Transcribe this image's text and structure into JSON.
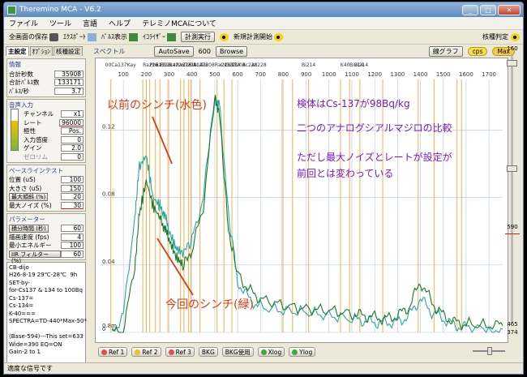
{
  "window": {
    "title": "Theremino MCA - V6.2"
  },
  "menu": [
    "ファイル",
    "ツール",
    "言語",
    "ヘルプ",
    "テレミノMCAについて"
  ],
  "toolbar": {
    "save_screen": "全画面の保存",
    "export": "ｴｸｽﾎﾟｰﾄ",
    "pulse_display": "ﾊﾟﾙｽ表示",
    "equalizer": "ｲｺﾗｲｻﾞｰ",
    "run_measure": "計測実行",
    "new_measure": "新規計測開始",
    "nuclide_id": "核種判定"
  },
  "left_tabs": [
    "主設定",
    "ｵﾌﾟｼｮﾝ",
    "核種設定"
  ],
  "info": {
    "title": "情報",
    "rows": [
      {
        "label": "合計秒数",
        "value": "35908"
      },
      {
        "label": "合計ﾊﾟﾙｽ数",
        "value": "133171"
      },
      {
        "label": "ﾊﾟﾙｽ/秒",
        "value": "3.7"
      }
    ]
  },
  "audio": {
    "title": "音声入力",
    "rows": [
      {
        "label": "チャンネル",
        "value": "x1"
      },
      {
        "label": "レート",
        "value": "96000"
      },
      {
        "label": "極性",
        "value": "Pos."
      },
      {
        "label": "入力感度",
        "value": "0"
      },
      {
        "label": "ゲイン",
        "value": "2.0"
      },
      {
        "label": "ゼロリム",
        "value": "0"
      }
    ]
  },
  "baseline": {
    "title": "ベースラインテスト",
    "rows": [
      {
        "label": "位置 (uS)",
        "value": "100"
      },
      {
        "label": "大きさ (uS)",
        "value": "150"
      },
      {
        "label": "最大傾斜 (%)",
        "value": "20"
      },
      {
        "label": "最大ノイズ (%)",
        "value": "30"
      }
    ]
  },
  "params": {
    "title": "パラメーター",
    "rows": [
      {
        "label": "積分時間 (秒)",
        "value": "60"
      },
      {
        "label": "描画速度 (fps)",
        "value": "4"
      },
      {
        "label": "最小エネルギー",
        "value": "100"
      },
      {
        "label": "IIR フィルター (%)",
        "value": "60"
      }
    ]
  },
  "notes": "CB-dijo\nH26-8-19 29℃-28℃  9h\nSET-by-\nfor-Cs137 & 134 to 100Bq\nCs-137=\nCs-134=\nK-40===\nSPECTRA=TD-440*Max-50*\n\n(Base-594)---This set=633\nWide=390 EQ=ON\nGain-2 to 1",
  "spectrum": {
    "title": "スペクトル",
    "autosave_label": "AutoSave",
    "autosave_value": "600",
    "browse_label": "Browse",
    "line_graph_label": "線グラフ",
    "cps_label": "cps",
    "max_label": "Max",
    "isotope_labels": [
      "00Ca137Kay",
      "Ra226",
      "Pb21",
      "Ra226",
      "Pb214",
      "Ra226",
      "Ra226",
      "Tl208",
      "Bi214",
      "Ac228",
      "Tl208",
      "Ra226",
      "Cs137",
      "Cs134",
      "Tl208",
      "Ac228",
      "Ac228",
      "Bi214",
      "K40",
      "Bi214",
      "Bi214"
    ]
  },
  "bottom_buttons": [
    {
      "label": "Ref 1",
      "color": "#e05050"
    },
    {
      "label": "Ref 2",
      "color": "#f0c020"
    },
    {
      "label": "Ref 3",
      "color": "#e05050"
    },
    {
      "label": "BKG",
      "color": ""
    },
    {
      "label": "BKG使用",
      "color": ""
    },
    {
      "label": "Xlog",
      "color": "#3aaa3a"
    },
    {
      "label": "Ylog",
      "color": "#3aaa3a"
    }
  ],
  "right_values": {
    "top": "160",
    "mid": "590",
    "bottom1": "465",
    "bottom2": "374"
  },
  "status": "適度な信号です",
  "annotations": {
    "sample": "検体はCs-137が98Bq/kg",
    "compare": "二つのアナログシアルマジロの比較",
    "note1": "ただし最大ノイズとレートが設定が",
    "note2": "前回とは変わっている",
    "prev": "以前のシンチ(水色)",
    "current": "今回のシンチ(緑)"
  },
  "chart_data": {
    "type": "line",
    "xlabel": "",
    "ylabel": "",
    "x_ticks": [
      100,
      200,
      300,
      400,
      500,
      600,
      700,
      800,
      900,
      1000,
      1100,
      1200,
      1300,
      1400,
      1500,
      1600,
      1700
    ],
    "y_ticks": [
      "0.12",
      "0.08",
      "0.04",
      "0",
      "0.8m"
    ],
    "series": [
      {
        "name": "以前のシンチ(水色)",
        "color": "#2aa89a",
        "x": [
          50,
          100,
          150,
          170,
          200,
          230,
          260,
          280,
          300,
          330,
          360,
          400,
          450,
          500,
          520,
          560,
          600,
          650,
          700,
          800,
          900,
          1000,
          1100,
          1150,
          1200,
          1250,
          1300,
          1350,
          1400,
          1450,
          1500,
          1550,
          1600,
          1700,
          1760
        ],
        "y": [
          0.0,
          0.01,
          0.07,
          0.098,
          0.105,
          0.08,
          0.075,
          0.07,
          0.06,
          0.05,
          0.047,
          0.055,
          0.08,
          0.14,
          0.135,
          0.07,
          0.03,
          0.02,
          0.015,
          0.013,
          0.012,
          0.01,
          0.008,
          0.007,
          0.006,
          0.006,
          0.006,
          0.01,
          0.02,
          0.012,
          0.008,
          0.004,
          0.003,
          0.002,
          0.002
        ]
      },
      {
        "name": "今回のシンチ(緑)",
        "color": "#1a7a2a",
        "x": [
          50,
          100,
          150,
          170,
          200,
          230,
          260,
          280,
          300,
          330,
          360,
          400,
          450,
          500,
          520,
          560,
          600,
          650,
          700,
          800,
          900,
          1000,
          1100,
          1150,
          1200,
          1250,
          1300,
          1350,
          1400,
          1450,
          1500,
          1550,
          1600,
          1700,
          1760
        ],
        "y": [
          0.0,
          0.0,
          0.04,
          0.07,
          0.09,
          0.075,
          0.068,
          0.062,
          0.055,
          0.045,
          0.04,
          0.048,
          0.075,
          0.14,
          0.13,
          0.06,
          0.035,
          0.025,
          0.02,
          0.016,
          0.014,
          0.013,
          0.011,
          0.01,
          0.009,
          0.008,
          0.01,
          0.015,
          0.03,
          0.018,
          0.01,
          0.006,
          0.005,
          0.004,
          0.004
        ]
      }
    ]
  }
}
